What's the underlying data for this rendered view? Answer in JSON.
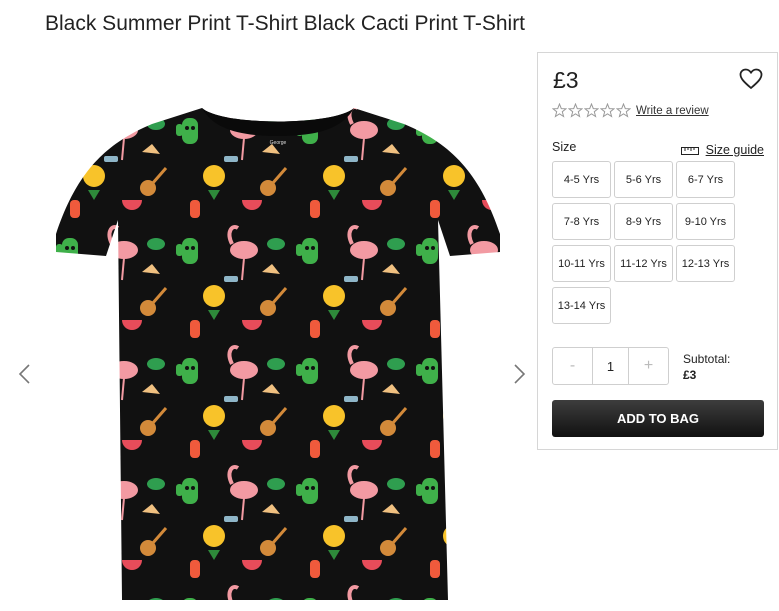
{
  "product": {
    "title": "Black Summer Print T-Shirt Black Cacti Print T-Shirt",
    "price": "£3",
    "review_link": "Write a review",
    "rating_stars": 0,
    "size_label": "Size",
    "size_guide": "Size guide",
    "sizes": [
      "4-5 Yrs",
      "5-6 Yrs",
      "6-7 Yrs",
      "7-8 Yrs",
      "8-9 Yrs",
      "9-10 Yrs",
      "10-11 Yrs",
      "11-12 Yrs",
      "12-13 Yrs",
      "13-14 Yrs"
    ],
    "quantity": "1",
    "minus": "-",
    "plus": "+",
    "subtotal_label": "Subtotal:",
    "subtotal_value": "£3",
    "add_to_bag": "ADD TO BAG",
    "brand_tag": "George"
  },
  "colors": {
    "shirt": "#111111",
    "button_dark": "#222222",
    "border": "#d6d6d6"
  },
  "icons": {
    "favourite": "heart-outline-icon",
    "size_guide": "ruler-icon",
    "prev": "chevron-left-icon",
    "next": "chevron-right-icon",
    "star": "star-outline-icon"
  }
}
